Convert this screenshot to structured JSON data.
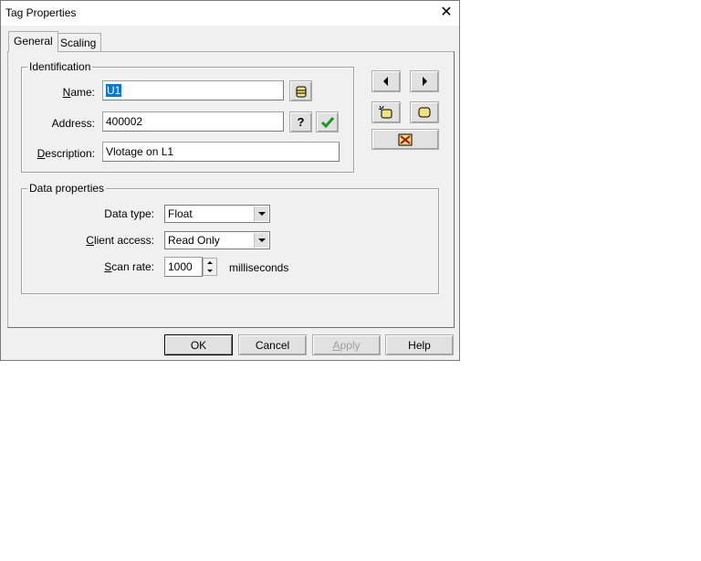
{
  "window": {
    "title": "Tag Properties"
  },
  "tabs": [
    {
      "label": "General",
      "active": true
    },
    {
      "label": "Scaling",
      "active": false
    }
  ],
  "identification": {
    "legend": "Identification",
    "name_label_u": "N",
    "name_label_rest": "ame:",
    "name_value": "U1",
    "address_label": "Address:",
    "address_value": "400002",
    "description_label_u": "D",
    "description_label_rest": "escription:",
    "description_value": "Vlotage on L1"
  },
  "data_properties": {
    "legend": "Data properties",
    "data_type_label": "Data type:",
    "data_type_value": "Float",
    "client_access_label_u": "C",
    "client_access_label_rest": "lient access:",
    "client_access_value": "Read Only",
    "scan_rate_label_u": "S",
    "scan_rate_label_rest": "can rate:",
    "scan_rate_value": "1000",
    "scan_rate_unit": "milliseconds"
  },
  "buttons": {
    "ok": "OK",
    "cancel": "Cancel",
    "apply_u": "A",
    "apply_rest": "pply",
    "help": "Help"
  },
  "colors": {
    "selection": "#0078d7",
    "check": "#1a9a1a",
    "icon_yellow": "#f5e27a"
  }
}
